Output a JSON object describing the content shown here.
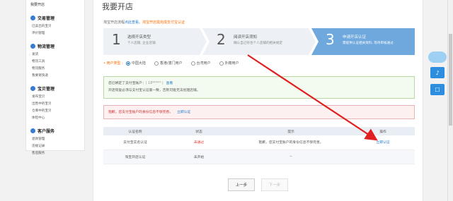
{
  "sidebar": {
    "top_item": "我要开店",
    "groups": [
      {
        "icon": "trade-icon",
        "title": "交易管理",
        "items": [
          "已卖出的宝贝",
          "评价管理"
        ]
      },
      {
        "icon": "logistics-icon",
        "title": "物流管理",
        "items": [
          "发货",
          "物流工具",
          "物流服务",
          "我要寄快递"
        ]
      },
      {
        "icon": "goods-icon",
        "title": "宝贝管理",
        "items": [
          "发布宝贝",
          "出售中的宝贝",
          "仓库中的宝贝",
          "体检中心"
        ]
      },
      {
        "icon": "service-icon",
        "title": "客户服务",
        "items": [
          "退款管理",
          "违规记录",
          "售后服务"
        ]
      }
    ]
  },
  "page": {
    "title": "我要开店",
    "notice_prefix": "淘宝开店流程",
    "notice_link": "点此查看",
    "notice_sep": "。",
    "notice_orange": "淘宝开店需完成支付宝认证"
  },
  "steps": [
    {
      "num": "1",
      "title": "选择开店类型",
      "desc": "个人店铺, 企业店铺"
    },
    {
      "num": "2",
      "title": "阅读开店须知",
      "desc": "确认自己符合个人店铺的相关规定"
    },
    {
      "num": "3",
      "title": "申请开店认证",
      "desc": "需提供认证相关资料, 等待审核通过"
    }
  ],
  "user_type": {
    "label": "• 用户类型 :",
    "options": [
      {
        "label": "中国大陆",
        "selected": true
      },
      {
        "label": "香港/澳门用户",
        "selected": false
      },
      {
        "label": "台湾用户",
        "selected": false
      },
      {
        "label": "外籍用户",
        "selected": false
      }
    ]
  },
  "green_box": {
    "line1_prefix": "您已绑定了支付宝账户：",
    "account": "( 18*****  )",
    "line1_link": "查看",
    "line2": "开店恢复必须与支付宝认证第一致，否则可能无法创建店铺。"
  },
  "red_box": {
    "text": "抱歉，您支付宝账户的身份信息不够完善。",
    "link": "立即认证"
  },
  "table": {
    "headers": [
      "认证名称",
      "状态",
      "提示",
      "操作"
    ],
    "rows": [
      {
        "name": "支付宝实名认证",
        "status": "未通过",
        "tip": "抱歉，您支付宝账户的身份信息不够完善。",
        "action": "立即认证"
      },
      {
        "name": "淘宝开店认证",
        "status": "未开始",
        "tip": "--",
        "action": ""
      }
    ]
  },
  "buttons": {
    "prev": "上一步",
    "next": "下一步"
  },
  "colors": {
    "accent": "#1a73c9",
    "step_active": "#6fa8dc",
    "arrow": "#e02020",
    "warn": "#ff6a00"
  }
}
